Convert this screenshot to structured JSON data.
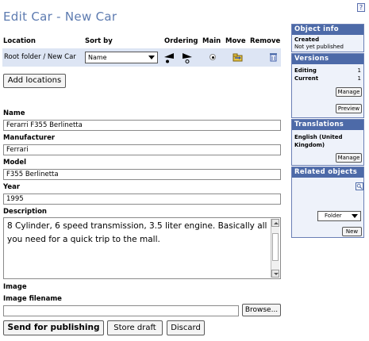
{
  "help_label": "?",
  "page_title": "Edit Car - New Car",
  "locations": {
    "headers": {
      "location": "Location",
      "sort_by": "Sort by",
      "ordering": "Ordering",
      "main": "Main",
      "move": "Move",
      "remove": "Remove"
    },
    "rows": [
      {
        "path": "Root folder / New Car",
        "sort_value": "Name"
      }
    ],
    "add_button": "Add locations"
  },
  "fields": {
    "name_label": "Name",
    "name_value": "Ferarri F355 Berlinetta",
    "manufacturer_label": "Manufacturer",
    "manufacturer_value": "Ferrari",
    "model_label": "Model",
    "model_value": "F355 Berlinetta",
    "year_label": "Year",
    "year_value": "1995",
    "description_label": "Description",
    "description_value": "8 Cylinder, 6 speed transmission, 3.5 liter engine. Basically all you need for a quick trip to the mall.",
    "image_label": "Image",
    "image_filename_label": "Image filename",
    "image_filename_value": "",
    "browse_button": "Browse..."
  },
  "actions": {
    "send": "Send for publishing",
    "store_draft": "Store draft",
    "discard": "Discard"
  },
  "sidebar": {
    "object_info": {
      "title": "Object info",
      "created_label": "Created",
      "created_value": "Not yet published"
    },
    "versions": {
      "title": "Versions",
      "editing_label": "Editing",
      "editing_value": "1",
      "current_label": "Current",
      "current_value": "1",
      "manage_button": "Manage",
      "preview_button": "Preview"
    },
    "translations": {
      "title": "Translations",
      "language": "English (United Kingdom)",
      "manage_button": "Manage"
    },
    "related_objects": {
      "title": "Related objects",
      "class_select": "Folder",
      "new_button": "New"
    }
  },
  "colors": {
    "title": "#5d7bb0",
    "panel_header": "#4d6aa8",
    "location_row": "#dde5f4"
  }
}
